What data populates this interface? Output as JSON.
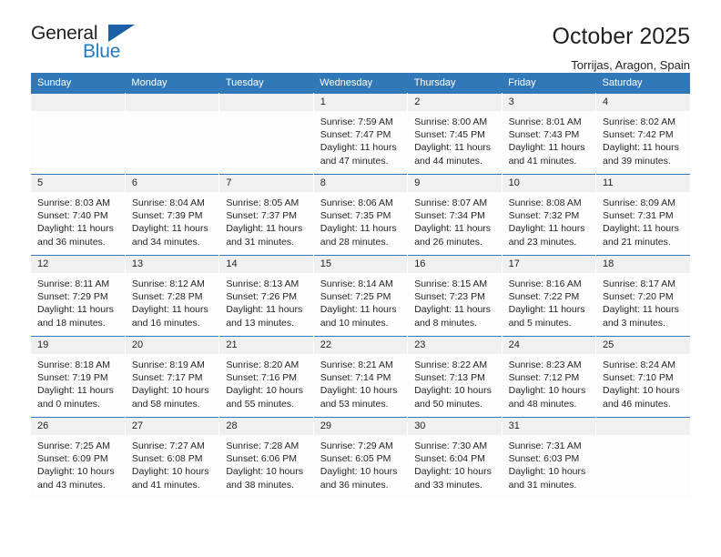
{
  "brand": {
    "name_dark": "General",
    "name_light": "Blue",
    "accent_color": "#1f7bc4",
    "triangle_color": "#1b5fa8"
  },
  "header": {
    "title": "October 2025",
    "subtitle": "Torrijas, Aragon, Spain"
  },
  "calendar": {
    "header_color": "#3178b8",
    "daynum_background": "#f0f0f0",
    "weekday_headers": [
      "Sunday",
      "Monday",
      "Tuesday",
      "Wednesday",
      "Thursday",
      "Friday",
      "Saturday"
    ],
    "weeks": [
      [
        {
          "day": "",
          "empty": true
        },
        {
          "day": "",
          "empty": true
        },
        {
          "day": "",
          "empty": true
        },
        {
          "day": "1",
          "sunrise": "Sunrise: 7:59 AM",
          "sunset": "Sunset: 7:47 PM",
          "daylight_line1": "Daylight: 11 hours",
          "daylight_line2": "and 47 minutes."
        },
        {
          "day": "2",
          "sunrise": "Sunrise: 8:00 AM",
          "sunset": "Sunset: 7:45 PM",
          "daylight_line1": "Daylight: 11 hours",
          "daylight_line2": "and 44 minutes."
        },
        {
          "day": "3",
          "sunrise": "Sunrise: 8:01 AM",
          "sunset": "Sunset: 7:43 PM",
          "daylight_line1": "Daylight: 11 hours",
          "daylight_line2": "and 41 minutes."
        },
        {
          "day": "4",
          "sunrise": "Sunrise: 8:02 AM",
          "sunset": "Sunset: 7:42 PM",
          "daylight_line1": "Daylight: 11 hours",
          "daylight_line2": "and 39 minutes."
        }
      ],
      [
        {
          "day": "5",
          "sunrise": "Sunrise: 8:03 AM",
          "sunset": "Sunset: 7:40 PM",
          "daylight_line1": "Daylight: 11 hours",
          "daylight_line2": "and 36 minutes."
        },
        {
          "day": "6",
          "sunrise": "Sunrise: 8:04 AM",
          "sunset": "Sunset: 7:39 PM",
          "daylight_line1": "Daylight: 11 hours",
          "daylight_line2": "and 34 minutes."
        },
        {
          "day": "7",
          "sunrise": "Sunrise: 8:05 AM",
          "sunset": "Sunset: 7:37 PM",
          "daylight_line1": "Daylight: 11 hours",
          "daylight_line2": "and 31 minutes."
        },
        {
          "day": "8",
          "sunrise": "Sunrise: 8:06 AM",
          "sunset": "Sunset: 7:35 PM",
          "daylight_line1": "Daylight: 11 hours",
          "daylight_line2": "and 28 minutes."
        },
        {
          "day": "9",
          "sunrise": "Sunrise: 8:07 AM",
          "sunset": "Sunset: 7:34 PM",
          "daylight_line1": "Daylight: 11 hours",
          "daylight_line2": "and 26 minutes."
        },
        {
          "day": "10",
          "sunrise": "Sunrise: 8:08 AM",
          "sunset": "Sunset: 7:32 PM",
          "daylight_line1": "Daylight: 11 hours",
          "daylight_line2": "and 23 minutes."
        },
        {
          "day": "11",
          "sunrise": "Sunrise: 8:09 AM",
          "sunset": "Sunset: 7:31 PM",
          "daylight_line1": "Daylight: 11 hours",
          "daylight_line2": "and 21 minutes."
        }
      ],
      [
        {
          "day": "12",
          "sunrise": "Sunrise: 8:11 AM",
          "sunset": "Sunset: 7:29 PM",
          "daylight_line1": "Daylight: 11 hours",
          "daylight_line2": "and 18 minutes."
        },
        {
          "day": "13",
          "sunrise": "Sunrise: 8:12 AM",
          "sunset": "Sunset: 7:28 PM",
          "daylight_line1": "Daylight: 11 hours",
          "daylight_line2": "and 16 minutes."
        },
        {
          "day": "14",
          "sunrise": "Sunrise: 8:13 AM",
          "sunset": "Sunset: 7:26 PM",
          "daylight_line1": "Daylight: 11 hours",
          "daylight_line2": "and 13 minutes."
        },
        {
          "day": "15",
          "sunrise": "Sunrise: 8:14 AM",
          "sunset": "Sunset: 7:25 PM",
          "daylight_line1": "Daylight: 11 hours",
          "daylight_line2": "and 10 minutes."
        },
        {
          "day": "16",
          "sunrise": "Sunrise: 8:15 AM",
          "sunset": "Sunset: 7:23 PM",
          "daylight_line1": "Daylight: 11 hours",
          "daylight_line2": "and 8 minutes."
        },
        {
          "day": "17",
          "sunrise": "Sunrise: 8:16 AM",
          "sunset": "Sunset: 7:22 PM",
          "daylight_line1": "Daylight: 11 hours",
          "daylight_line2": "and 5 minutes."
        },
        {
          "day": "18",
          "sunrise": "Sunrise: 8:17 AM",
          "sunset": "Sunset: 7:20 PM",
          "daylight_line1": "Daylight: 11 hours",
          "daylight_line2": "and 3 minutes."
        }
      ],
      [
        {
          "day": "19",
          "sunrise": "Sunrise: 8:18 AM",
          "sunset": "Sunset: 7:19 PM",
          "daylight_line1": "Daylight: 11 hours",
          "daylight_line2": "and 0 minutes."
        },
        {
          "day": "20",
          "sunrise": "Sunrise: 8:19 AM",
          "sunset": "Sunset: 7:17 PM",
          "daylight_line1": "Daylight: 10 hours",
          "daylight_line2": "and 58 minutes."
        },
        {
          "day": "21",
          "sunrise": "Sunrise: 8:20 AM",
          "sunset": "Sunset: 7:16 PM",
          "daylight_line1": "Daylight: 10 hours",
          "daylight_line2": "and 55 minutes."
        },
        {
          "day": "22",
          "sunrise": "Sunrise: 8:21 AM",
          "sunset": "Sunset: 7:14 PM",
          "daylight_line1": "Daylight: 10 hours",
          "daylight_line2": "and 53 minutes."
        },
        {
          "day": "23",
          "sunrise": "Sunrise: 8:22 AM",
          "sunset": "Sunset: 7:13 PM",
          "daylight_line1": "Daylight: 10 hours",
          "daylight_line2": "and 50 minutes."
        },
        {
          "day": "24",
          "sunrise": "Sunrise: 8:23 AM",
          "sunset": "Sunset: 7:12 PM",
          "daylight_line1": "Daylight: 10 hours",
          "daylight_line2": "and 48 minutes."
        },
        {
          "day": "25",
          "sunrise": "Sunrise: 8:24 AM",
          "sunset": "Sunset: 7:10 PM",
          "daylight_line1": "Daylight: 10 hours",
          "daylight_line2": "and 46 minutes."
        }
      ],
      [
        {
          "day": "26",
          "sunrise": "Sunrise: 7:25 AM",
          "sunset": "Sunset: 6:09 PM",
          "daylight_line1": "Daylight: 10 hours",
          "daylight_line2": "and 43 minutes."
        },
        {
          "day": "27",
          "sunrise": "Sunrise: 7:27 AM",
          "sunset": "Sunset: 6:08 PM",
          "daylight_line1": "Daylight: 10 hours",
          "daylight_line2": "and 41 minutes."
        },
        {
          "day": "28",
          "sunrise": "Sunrise: 7:28 AM",
          "sunset": "Sunset: 6:06 PM",
          "daylight_line1": "Daylight: 10 hours",
          "daylight_line2": "and 38 minutes."
        },
        {
          "day": "29",
          "sunrise": "Sunrise: 7:29 AM",
          "sunset": "Sunset: 6:05 PM",
          "daylight_line1": "Daylight: 10 hours",
          "daylight_line2": "and 36 minutes."
        },
        {
          "day": "30",
          "sunrise": "Sunrise: 7:30 AM",
          "sunset": "Sunset: 6:04 PM",
          "daylight_line1": "Daylight: 10 hours",
          "daylight_line2": "and 33 minutes."
        },
        {
          "day": "31",
          "sunrise": "Sunrise: 7:31 AM",
          "sunset": "Sunset: 6:03 PM",
          "daylight_line1": "Daylight: 10 hours",
          "daylight_line2": "and 31 minutes."
        },
        {
          "day": "",
          "empty": true
        }
      ]
    ]
  }
}
